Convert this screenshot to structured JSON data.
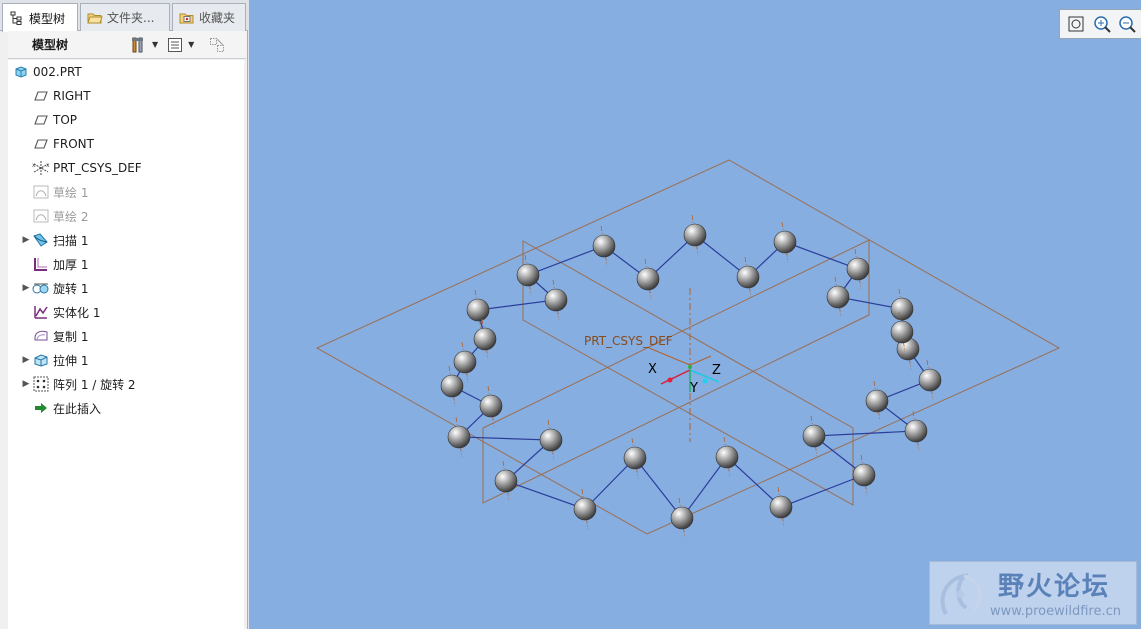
{
  "tabs": [
    {
      "label": "模型树"
    },
    {
      "label": "文件夹..."
    },
    {
      "label": "收藏夹"
    }
  ],
  "tree_toolbar": {
    "title": "模型树"
  },
  "tree": [
    {
      "label": "002.PRT",
      "icon": "part-icon",
      "expandable": false,
      "dim": false
    },
    {
      "label": "RIGHT",
      "icon": "datum-plane-icon",
      "expandable": false,
      "dim": false
    },
    {
      "label": "TOP",
      "icon": "datum-plane-icon",
      "expandable": false,
      "dim": false
    },
    {
      "label": "FRONT",
      "icon": "datum-plane-icon",
      "expandable": false,
      "dim": false
    },
    {
      "label": "PRT_CSYS_DEF",
      "icon": "csys-icon",
      "expandable": false,
      "dim": false
    },
    {
      "label": "草绘 1",
      "icon": "sketch-icon",
      "expandable": false,
      "dim": true
    },
    {
      "label": "草绘 2",
      "icon": "sketch-icon",
      "expandable": false,
      "dim": true
    },
    {
      "label": "扫描 1",
      "icon": "sweep-icon",
      "expandable": true,
      "dim": false
    },
    {
      "label": "加厚 1",
      "icon": "thicken-icon",
      "expandable": false,
      "dim": false
    },
    {
      "label": "旋转 1",
      "icon": "revolve-icon",
      "expandable": true,
      "dim": false
    },
    {
      "label": "实体化 1",
      "icon": "solidify-icon",
      "expandable": false,
      "dim": false
    },
    {
      "label": "复制 1",
      "icon": "copy-icon",
      "expandable": false,
      "dim": false
    },
    {
      "label": "拉伸 1",
      "icon": "extrude-icon",
      "expandable": true,
      "dim": false
    },
    {
      "label": "阵列 1 / 旋转 2",
      "icon": "pattern-icon",
      "expandable": true,
      "dim": false
    },
    {
      "label": "在此插入",
      "icon": "insert-here-icon",
      "expandable": false,
      "dim": false
    }
  ],
  "view_toolbar": [
    "zoom-window-icon",
    "zoom-in-icon",
    "zoom-out-icon",
    "refit-icon",
    "reorient-icon",
    "saved-views-icon",
    "layers-icon",
    "appearance-icon",
    "spin-center-icon",
    "datum-display-icon",
    "csys-display-icon",
    "plane-display-icon",
    "axis-display-icon"
  ],
  "scene": {
    "csys_name": "PRT_CSYS_DEF",
    "axis_x": "X",
    "axis_y": "Y",
    "axis_z": "Z"
  },
  "watermark": {
    "brand": "野火论坛",
    "url": "www.proewildfire.cn"
  },
  "colors": {
    "viewport_bg": "#87aee0",
    "datum_plane": "#9a6e52",
    "curve": "#2b3d9a",
    "csys": "#b2622e"
  }
}
